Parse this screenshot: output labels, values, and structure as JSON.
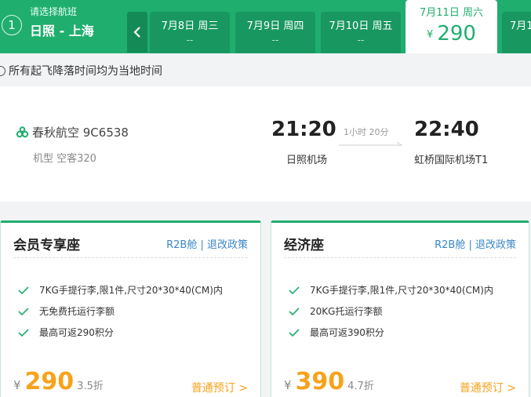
{
  "header": {
    "step": "1",
    "hint": "请选择航班",
    "route": "日照 - 上海",
    "dates": [
      {
        "date": "7月8日 周三",
        "price": "--"
      },
      {
        "date": "7月9日 周四",
        "price": "--"
      },
      {
        "date": "7月10日 周五",
        "price": "--"
      },
      {
        "date": "7月11日 周六",
        "currency": "¥",
        "price": "290",
        "active": true
      },
      {
        "date": "7月1"
      }
    ]
  },
  "notice": "所有起飞降落时间均为当地时间",
  "flight": {
    "airline": "春秋航空 9C6538",
    "aircraft": "机型 空客320",
    "dep_time": "21:20",
    "dep_airport": "日照机场",
    "duration": "1小时 20分",
    "arr_time": "22:40",
    "arr_airport": "虹桥国际机场T1"
  },
  "fares": [
    {
      "title": "会员专享座",
      "policy": "R2B舱 | 退改政策",
      "features": [
        "7KG手提行李,限1件,尺寸20*30*40(CM)内",
        "无免费托运行李额",
        "最高可返290积分"
      ],
      "currency": "¥",
      "price": "290",
      "discount": "3.5折",
      "book": "普通预订 >"
    },
    {
      "title": "经济座",
      "policy": "R2B舱 | 退改政策",
      "features": [
        "7KG手提行李,限1件,尺寸20*30*40(CM)内",
        "20KG托运行李额",
        "最高可返390积分"
      ],
      "currency": "¥",
      "price": "390",
      "discount": "4.7折",
      "book": "普通预订 >"
    }
  ],
  "colors": {
    "brand": "#1fae6e",
    "price": "#f7a21b",
    "link": "#3b87c7"
  }
}
